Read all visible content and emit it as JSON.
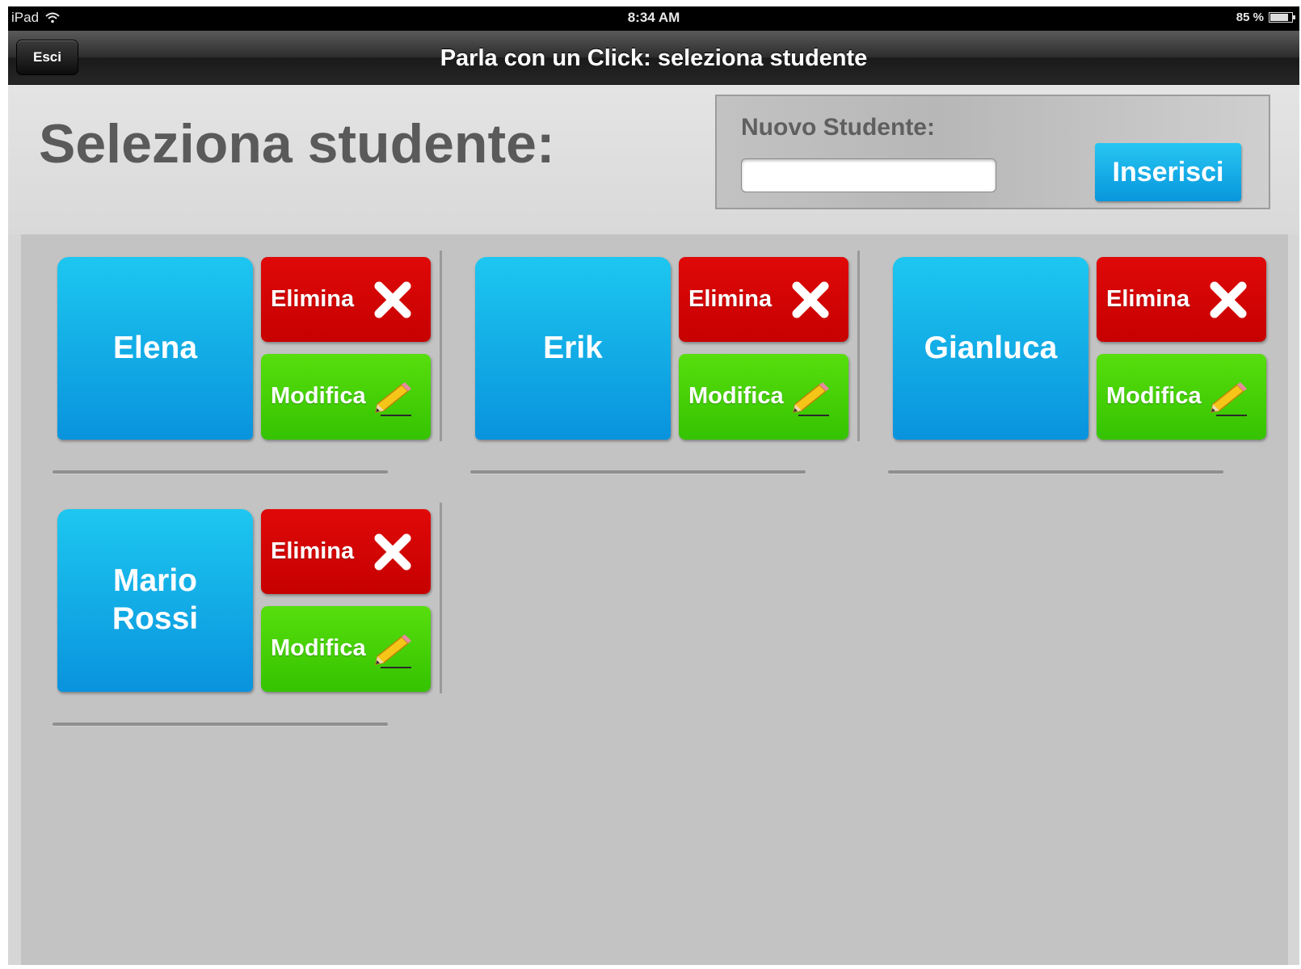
{
  "statusbar": {
    "device": "iPad",
    "time": "8:34 AM",
    "battery": "85 %",
    "battery_level": 0.85
  },
  "navbar": {
    "exit_label": "Esci",
    "title": "Parla con un Click: seleziona studente"
  },
  "header": {
    "title": "Seleziona studente:",
    "new_student_label": "Nuovo Studente:",
    "new_student_value": "",
    "insert_label": "Inserisci"
  },
  "students": [
    {
      "name": "Elena",
      "delete_label": "Elimina",
      "edit_label": "Modifica"
    },
    {
      "name": "Erik",
      "delete_label": "Elimina",
      "edit_label": "Modifica"
    },
    {
      "name": "Gianluca",
      "delete_label": "Elimina",
      "edit_label": "Modifica"
    },
    {
      "name": "Mario Rossi",
      "delete_label": "Elimina",
      "edit_label": "Modifica"
    }
  ],
  "colors": {
    "student_button": "#0fa9e6",
    "delete_button": "#d60404",
    "edit_button": "#46d008",
    "insert_button": "#149fe3"
  },
  "icons": {
    "delete": "x-icon",
    "edit": "pencil-icon",
    "wifi": "wifi-icon",
    "battery": "battery-icon"
  }
}
